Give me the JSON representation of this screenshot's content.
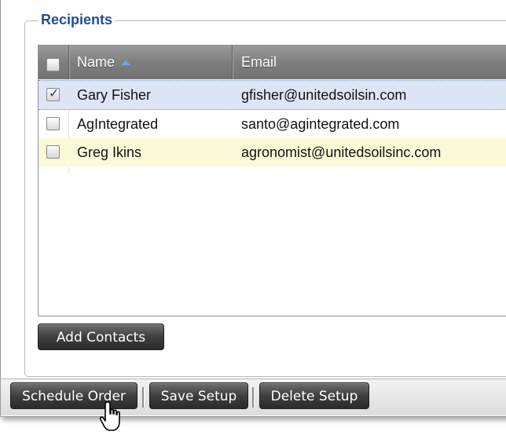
{
  "recipients": {
    "legend": "Recipients",
    "columns": {
      "name": "Name",
      "email": "Email"
    },
    "rows": [
      {
        "name": "Gary Fisher",
        "email": "gfisher@unitedsoilsin.com",
        "checked": true
      },
      {
        "name": "AgIntegrated",
        "email": "santo@agintegrated.com",
        "checked": false
      },
      {
        "name": "Greg Ikins",
        "email": "agronomist@unitedsoilsinc.com",
        "checked": false
      }
    ],
    "add_contacts_label": "Add Contacts"
  },
  "toolbar": {
    "schedule_order_label": "Schedule Order",
    "save_setup_label": "Save Setup",
    "delete_setup_label": "Delete Setup"
  },
  "icons": {
    "cursor": "hand-pointer-icon",
    "sort": "sort-ascending-icon",
    "check": "checkmark-icon"
  },
  "colors": {
    "legend": "#1f4d94",
    "selected_row": "#dce6f7",
    "alt_row": "#fbfad8",
    "header": "#7f7f7f"
  }
}
